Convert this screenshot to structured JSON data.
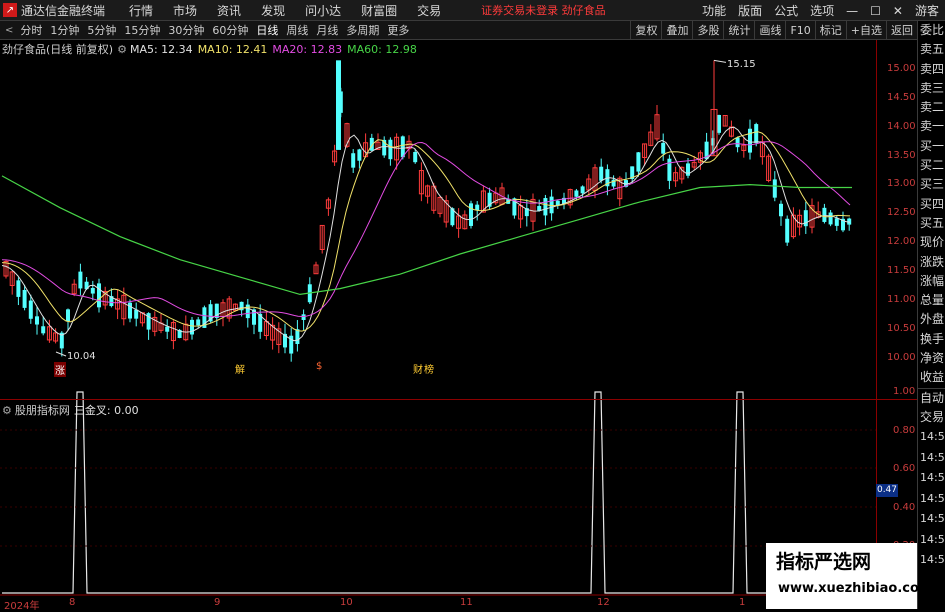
{
  "topbar": {
    "app_name": "通达信金融终端",
    "menu": [
      "行情",
      "市场",
      "资讯",
      "发现",
      "问小达",
      "财富圈",
      "交易"
    ],
    "notice": "证券交易未登录   劲仔食品",
    "right_menu": [
      "功能",
      "版面",
      "公式",
      "选项"
    ],
    "guest": "游客"
  },
  "periodbar": {
    "periods": [
      "分时",
      "1分钟",
      "5分钟",
      "15分钟",
      "30分钟",
      "60分钟",
      "日线",
      "周线",
      "月线",
      "多周期",
      "更多"
    ],
    "active": "日线",
    "tools": [
      "复权",
      "叠加",
      "多股",
      "统计",
      "画线",
      "F10",
      "标记",
      "+自选",
      "返回"
    ]
  },
  "chart": {
    "stock_title": "劲仔食品(日线 前复权)",
    "ma5": "MA5: 12.34",
    "ma10": "MA10: 12.41",
    "ma20": "MA20: 12.83",
    "ma60": "MA60: 12.98",
    "high_label": "15.15",
    "low_label": "10.04",
    "price_ticks": [
      "15.00",
      "14.50",
      "14.00",
      "13.50",
      "13.00",
      "12.50",
      "12.00",
      "11.50",
      "11.00",
      "10.50",
      "10.00"
    ],
    "markers": [
      "涨",
      "解",
      "$",
      "财",
      "榜"
    ]
  },
  "indicator": {
    "title": "股朋指标网",
    "formula": "三金叉: 0.00",
    "ticks": [
      "1.00",
      "0.80",
      "0.60",
      "0.40",
      "0.20"
    ],
    "current": "0.47"
  },
  "dates": [
    "2024年",
    "8",
    "9",
    "10",
    "11",
    "12",
    "1"
  ],
  "sidepanel": {
    "labels": [
      "委比",
      "卖五",
      "卖四",
      "卖三",
      "卖二",
      "卖一",
      "买一",
      "买二",
      "买三",
      "买四",
      "买五",
      "现价",
      "涨跌",
      "涨幅",
      "总量",
      "外盘",
      "换手",
      "净资",
      "收益"
    ],
    "lower": [
      "自动",
      "交易"
    ],
    "times": [
      "14:56",
      "14:56",
      "14:56",
      "14:56",
      "14:56",
      "14:56",
      "14:56"
    ]
  },
  "watermark": {
    "main": "指标严选网",
    "sub": "www.xuezhibiao.com"
  },
  "colors": {
    "up": "#ff3c3c",
    "down": "#54ffff",
    "ma5": "#e0e0e0",
    "ma10": "#f1e26a",
    "ma20": "#e24ce2",
    "ma60": "#47d447"
  }
}
